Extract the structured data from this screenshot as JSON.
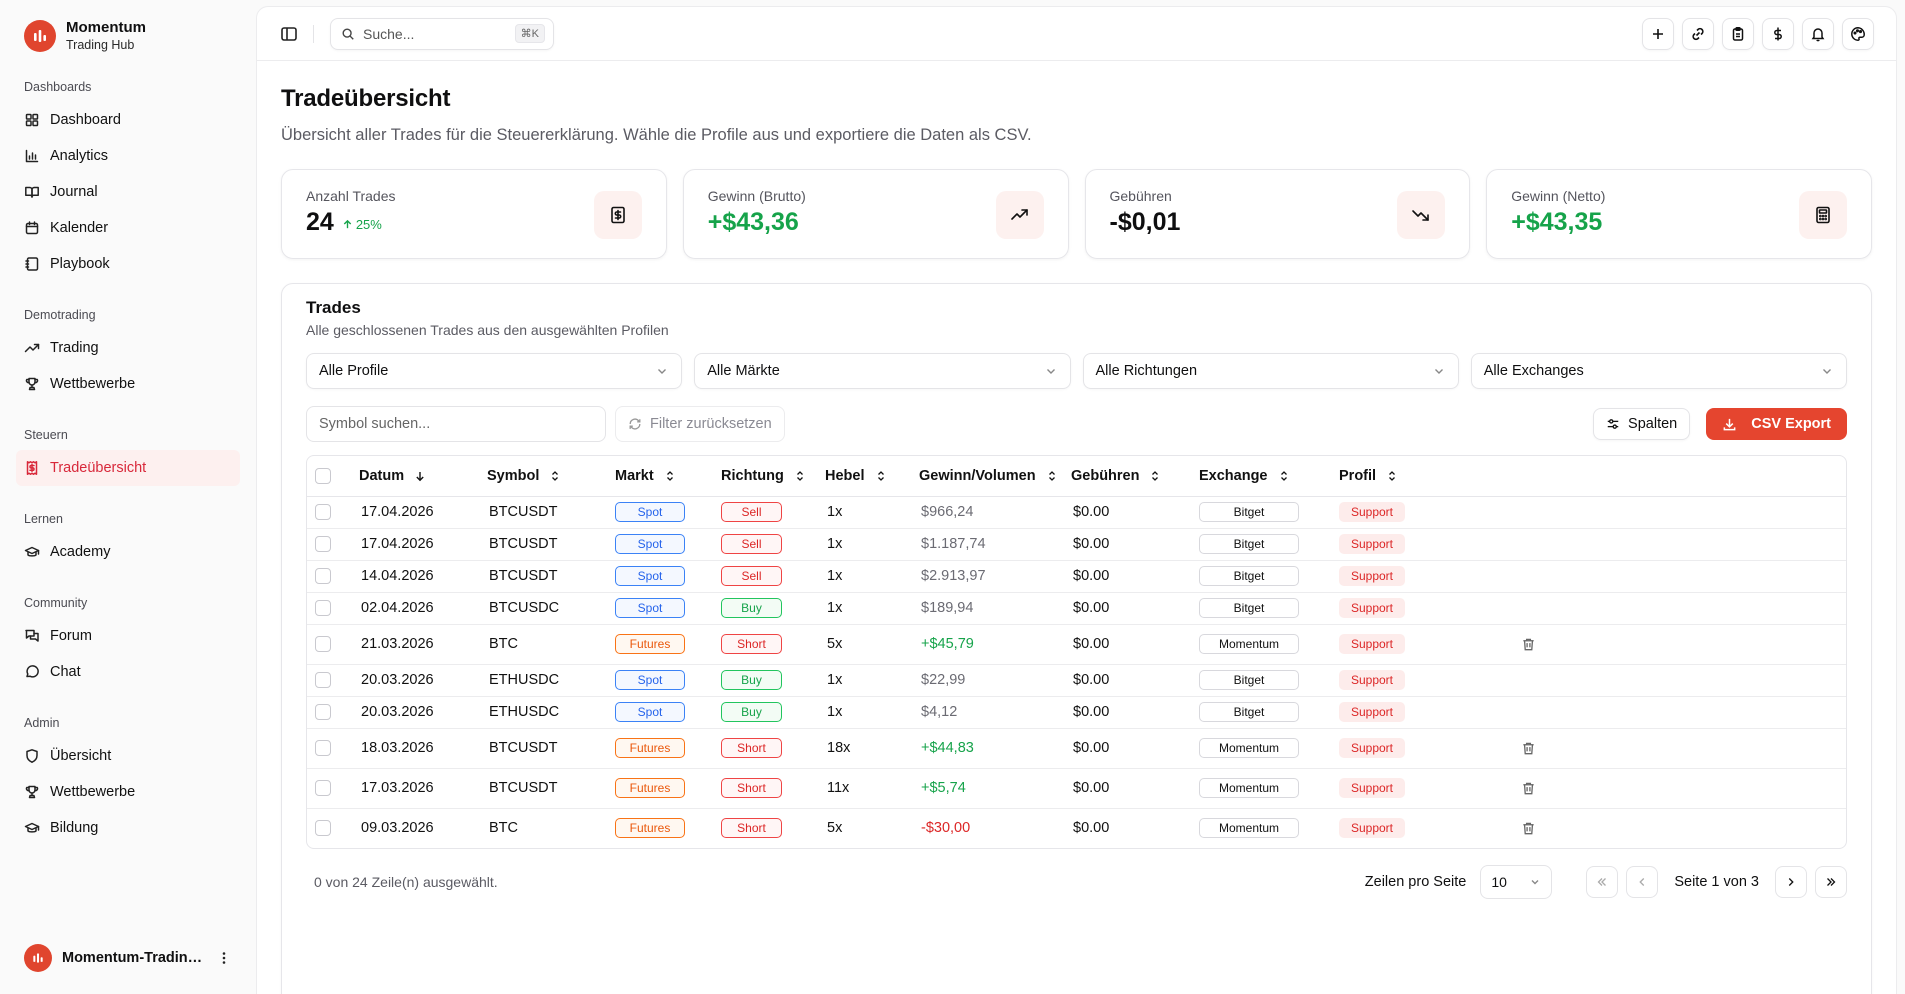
{
  "brand": {
    "name": "Momentum",
    "sub": "Trading Hub",
    "color": "#e0452e"
  },
  "sidebar": {
    "groups": [
      {
        "label": "Dashboards",
        "items": [
          {
            "label": "Dashboard",
            "icon": "layout-grid-icon"
          },
          {
            "label": "Analytics",
            "icon": "bar-chart-icon"
          },
          {
            "label": "Journal",
            "icon": "book-open-icon"
          },
          {
            "label": "Kalender",
            "icon": "calendar-icon"
          },
          {
            "label": "Playbook",
            "icon": "notebook-icon"
          }
        ]
      },
      {
        "label": "Demotrading",
        "items": [
          {
            "label": "Trading",
            "icon": "trending-up-icon"
          },
          {
            "label": "Wettbewerbe",
            "icon": "trophy-icon"
          }
        ]
      },
      {
        "label": "Steuern",
        "items": [
          {
            "label": "Tradeübersicht",
            "icon": "receipt-icon",
            "active": true
          }
        ]
      },
      {
        "label": "Lernen",
        "items": [
          {
            "label": "Academy",
            "icon": "graduation-cap-icon"
          }
        ]
      },
      {
        "label": "Community",
        "items": [
          {
            "label": "Forum",
            "icon": "messages-icon"
          },
          {
            "label": "Chat",
            "icon": "message-circle-icon"
          }
        ]
      },
      {
        "label": "Admin",
        "items": [
          {
            "label": "Übersicht",
            "icon": "shield-icon"
          },
          {
            "label": "Wettbewerbe",
            "icon": "trophy-icon"
          },
          {
            "label": "Bildung",
            "icon": "graduation-cap-icon"
          }
        ]
      }
    ],
    "footer_name": "Momentum-Trading Hub"
  },
  "topbar": {
    "search_placeholder": "Suche...",
    "shortcut": "⌘K"
  },
  "page": {
    "title": "Tradeübersicht",
    "description": "Übersicht aller Trades für die Steuererklärung. Wähle die Profile aus und exportiere die Daten als CSV."
  },
  "stats": [
    {
      "label": "Anzahl Trades",
      "value": "24",
      "trend": "25%",
      "positive": false,
      "icon": "receipt-dollar-icon"
    },
    {
      "label": "Gewinn (Brutto)",
      "value": "+$43,36",
      "trend": "",
      "positive": true,
      "icon": "trending-up-icon"
    },
    {
      "label": "Gebühren",
      "value": "-$0,01",
      "trend": "",
      "positive": false,
      "icon": "trending-down-icon"
    },
    {
      "label": "Gewinn (Netto)",
      "value": "+$43,35",
      "trend": "",
      "positive": true,
      "icon": "calculator-icon"
    }
  ],
  "trades_card": {
    "title": "Trades",
    "subtitle": "Alle geschlossenen Trades aus den ausgewählten Profilen",
    "filters": [
      "Alle Profile",
      "Alle Märkte",
      "Alle Richtungen",
      "Alle Exchanges"
    ],
    "symbol_placeholder": "Symbol suchen...",
    "reset_label": "Filter zurücksetzen",
    "columns_label": "Spalten",
    "export_label": "CSV Export"
  },
  "table": {
    "headers": [
      "Datum",
      "Symbol",
      "Markt",
      "Richtung",
      "Hebel",
      "Gewinn/Volumen",
      "Gebühren",
      "Exchange",
      "Profil"
    ],
    "rows": [
      {
        "date": "17.04.2026",
        "symbol": "BTCUSDT",
        "market": "Spot",
        "direction": "Sell",
        "leverage": "1x",
        "pnl": "$966,24",
        "pnl_type": "neutral",
        "fees": "$0.00",
        "exchange": "Bitget",
        "profile": "Support",
        "deletable": false
      },
      {
        "date": "17.04.2026",
        "symbol": "BTCUSDT",
        "market": "Spot",
        "direction": "Sell",
        "leverage": "1x",
        "pnl": "$1.187,74",
        "pnl_type": "neutral",
        "fees": "$0.00",
        "exchange": "Bitget",
        "profile": "Support",
        "deletable": false
      },
      {
        "date": "14.04.2026",
        "symbol": "BTCUSDT",
        "market": "Spot",
        "direction": "Sell",
        "leverage": "1x",
        "pnl": "$2.913,97",
        "pnl_type": "neutral",
        "fees": "$0.00",
        "exchange": "Bitget",
        "profile": "Support",
        "deletable": false
      },
      {
        "date": "02.04.2026",
        "symbol": "BTCUSDC",
        "market": "Spot",
        "direction": "Buy",
        "leverage": "1x",
        "pnl": "$189,94",
        "pnl_type": "neutral",
        "fees": "$0.00",
        "exchange": "Bitget",
        "profile": "Support",
        "deletable": false
      },
      {
        "date": "21.03.2026",
        "symbol": "BTC",
        "market": "Futures",
        "direction": "Short",
        "leverage": "5x",
        "pnl": "+$45,79",
        "pnl_type": "pos",
        "fees": "$0.00",
        "exchange": "Momentum",
        "profile": "Support",
        "deletable": true
      },
      {
        "date": "20.03.2026",
        "symbol": "ETHUSDC",
        "market": "Spot",
        "direction": "Buy",
        "leverage": "1x",
        "pnl": "$22,99",
        "pnl_type": "neutral",
        "fees": "$0.00",
        "exchange": "Bitget",
        "profile": "Support",
        "deletable": false
      },
      {
        "date": "20.03.2026",
        "symbol": "ETHUSDC",
        "market": "Spot",
        "direction": "Buy",
        "leverage": "1x",
        "pnl": "$4,12",
        "pnl_type": "neutral",
        "fees": "$0.00",
        "exchange": "Bitget",
        "profile": "Support",
        "deletable": false
      },
      {
        "date": "18.03.2026",
        "symbol": "BTCUSDT",
        "market": "Futures",
        "direction": "Short",
        "leverage": "18x",
        "pnl": "+$44,83",
        "pnl_type": "pos",
        "fees": "$0.00",
        "exchange": "Momentum",
        "profile": "Support",
        "deletable": true
      },
      {
        "date": "17.03.2026",
        "symbol": "BTCUSDT",
        "market": "Futures",
        "direction": "Short",
        "leverage": "11x",
        "pnl": "+$5,74",
        "pnl_type": "pos",
        "fees": "$0.00",
        "exchange": "Momentum",
        "profile": "Support",
        "deletable": true
      },
      {
        "date": "09.03.2026",
        "symbol": "BTC",
        "market": "Futures",
        "direction": "Short",
        "leverage": "5x",
        "pnl": "-$30,00",
        "pnl_type": "neg",
        "fees": "$0.00",
        "exchange": "Momentum",
        "profile": "Support",
        "deletable": true
      }
    ]
  },
  "footer": {
    "selection": "0 von 24 Zeile(n) ausgewählt.",
    "rows_per_page_label": "Zeilen pro Seite",
    "rows_per_page": "10",
    "page_info": "Seite 1 von 3"
  },
  "colors": {
    "accent": "#e5452f",
    "positive": "#16a34a",
    "negative": "#dc2626",
    "spot": "#2563eb",
    "futures": "#ea580c"
  }
}
